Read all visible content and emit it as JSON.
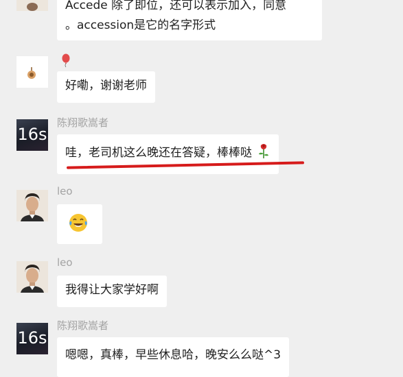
{
  "messages": [
    {
      "id": "m1",
      "sender": "",
      "lines": [
        "Accede 除了即位，还可以表示加入，同意",
        "。accession是它的名字形式"
      ]
    },
    {
      "id": "m2",
      "sender": "",
      "text": "好嘞，谢谢老师"
    },
    {
      "id": "m3",
      "sender": "陈翔歌嵩者",
      "avatar_text": "16s",
      "text": "哇，老司机这么晚还在答疑，棒棒哒",
      "emoji": "rose-emoji"
    },
    {
      "id": "m4",
      "sender": "leo",
      "emoji": "tears-of-joy-emoji"
    },
    {
      "id": "m5",
      "sender": "leo",
      "text": "我得让大家学好啊"
    },
    {
      "id": "m6",
      "sender": "陈翔歌嵩者",
      "avatar_text": "16s",
      "text": "嗯嗯，真棒，早些休息哈，晚安么么哒^3"
    }
  ],
  "colors": {
    "background": "#efefef",
    "bubble": "#ffffff",
    "sender": "#a3a3a3",
    "underline": "#d61b1b"
  }
}
